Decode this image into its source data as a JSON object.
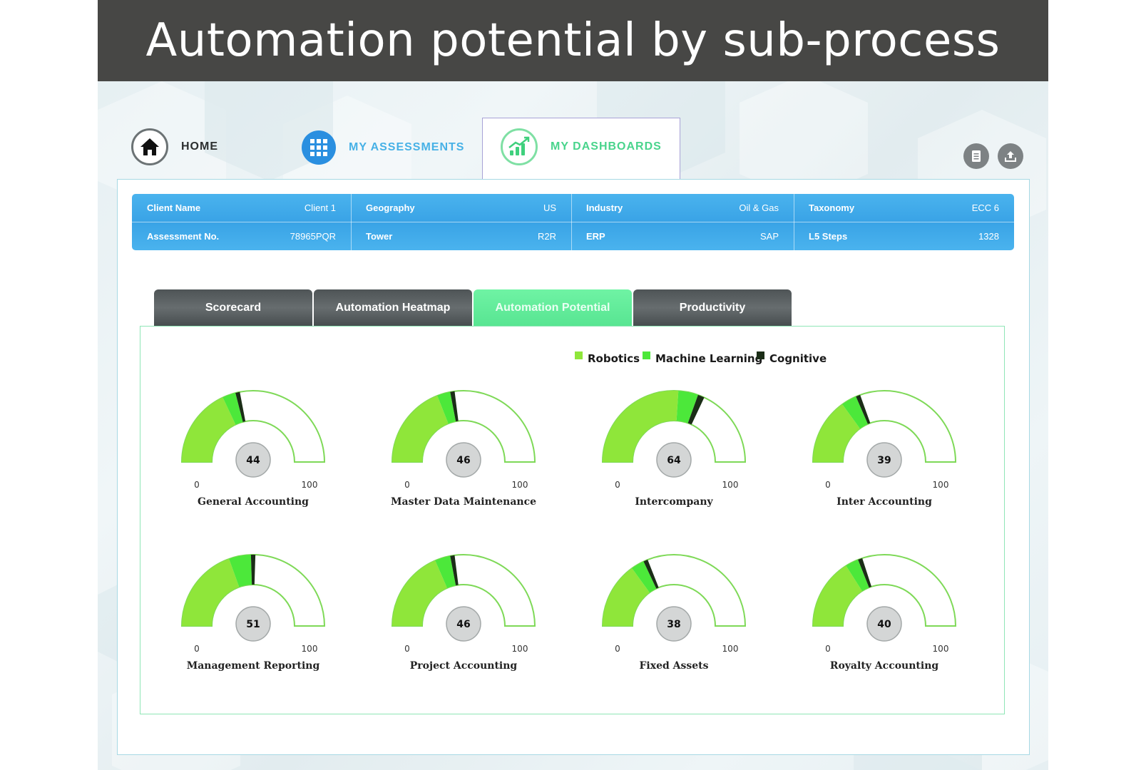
{
  "title": "Automation potential by sub-process",
  "nav": {
    "home": "HOME",
    "assessments": "MY ASSESSMENTS",
    "dashboards": "MY DASHBOARDS"
  },
  "icons": {
    "home": "home-icon",
    "assessments": "grid-icon",
    "dashboards": "chart-icon",
    "report": "document-icon",
    "export": "upload-icon"
  },
  "info": {
    "client_name_label": "Client Name",
    "client_name": "Client 1",
    "assessment_label": "Assessment No.",
    "assessment": "78965PQR",
    "geography_label": "Geography",
    "geography": "US",
    "tower_label": "Tower",
    "tower": "R2R",
    "industry_label": "Industry",
    "industry": "Oil & Gas",
    "erp_label": "ERP",
    "erp": "SAP",
    "taxonomy_label": "Taxonomy",
    "taxonomy": "ECC 6",
    "l5_label": "L5 Steps",
    "l5": "1328"
  },
  "tabs": [
    "Scorecard",
    "Automation Heatmap",
    "Automation Potential",
    "Productivity"
  ],
  "active_tab": "Automation Potential",
  "colors": {
    "robotics": "#8fe63a",
    "machine_learning": "#4ce83a",
    "cognitive": "#1b2d17",
    "gauge_outline": "#7ed957"
  },
  "chart_data": {
    "type": "gauge",
    "legend": [
      "Robotics",
      "Machine Learning",
      "Cognitive"
    ],
    "min": 0,
    "max": 100,
    "gauges": [
      {
        "label": "General Accounting",
        "value": 44,
        "robotics": 36,
        "machine_learning": 6,
        "cognitive": 2
      },
      {
        "label": "Master Data Maintenance",
        "value": 46,
        "robotics": 38,
        "machine_learning": 6,
        "cognitive": 2
      },
      {
        "label": "Intercompany",
        "value": 64,
        "robotics": 52,
        "machine_learning": 9,
        "cognitive": 3
      },
      {
        "label": "Inter Accounting",
        "value": 39,
        "robotics": 30,
        "machine_learning": 7,
        "cognitive": 2
      },
      {
        "label": "Management Reporting",
        "value": 51,
        "robotics": 39,
        "machine_learning": 10,
        "cognitive": 2
      },
      {
        "label": "Project Accounting",
        "value": 46,
        "robotics": 37,
        "machine_learning": 7,
        "cognitive": 2
      },
      {
        "label": "Fixed Assets",
        "value": 38,
        "robotics": 30,
        "machine_learning": 6,
        "cognitive": 2
      },
      {
        "label": "Royalty Accounting",
        "value": 40,
        "robotics": 32,
        "machine_learning": 6,
        "cognitive": 2
      }
    ]
  }
}
